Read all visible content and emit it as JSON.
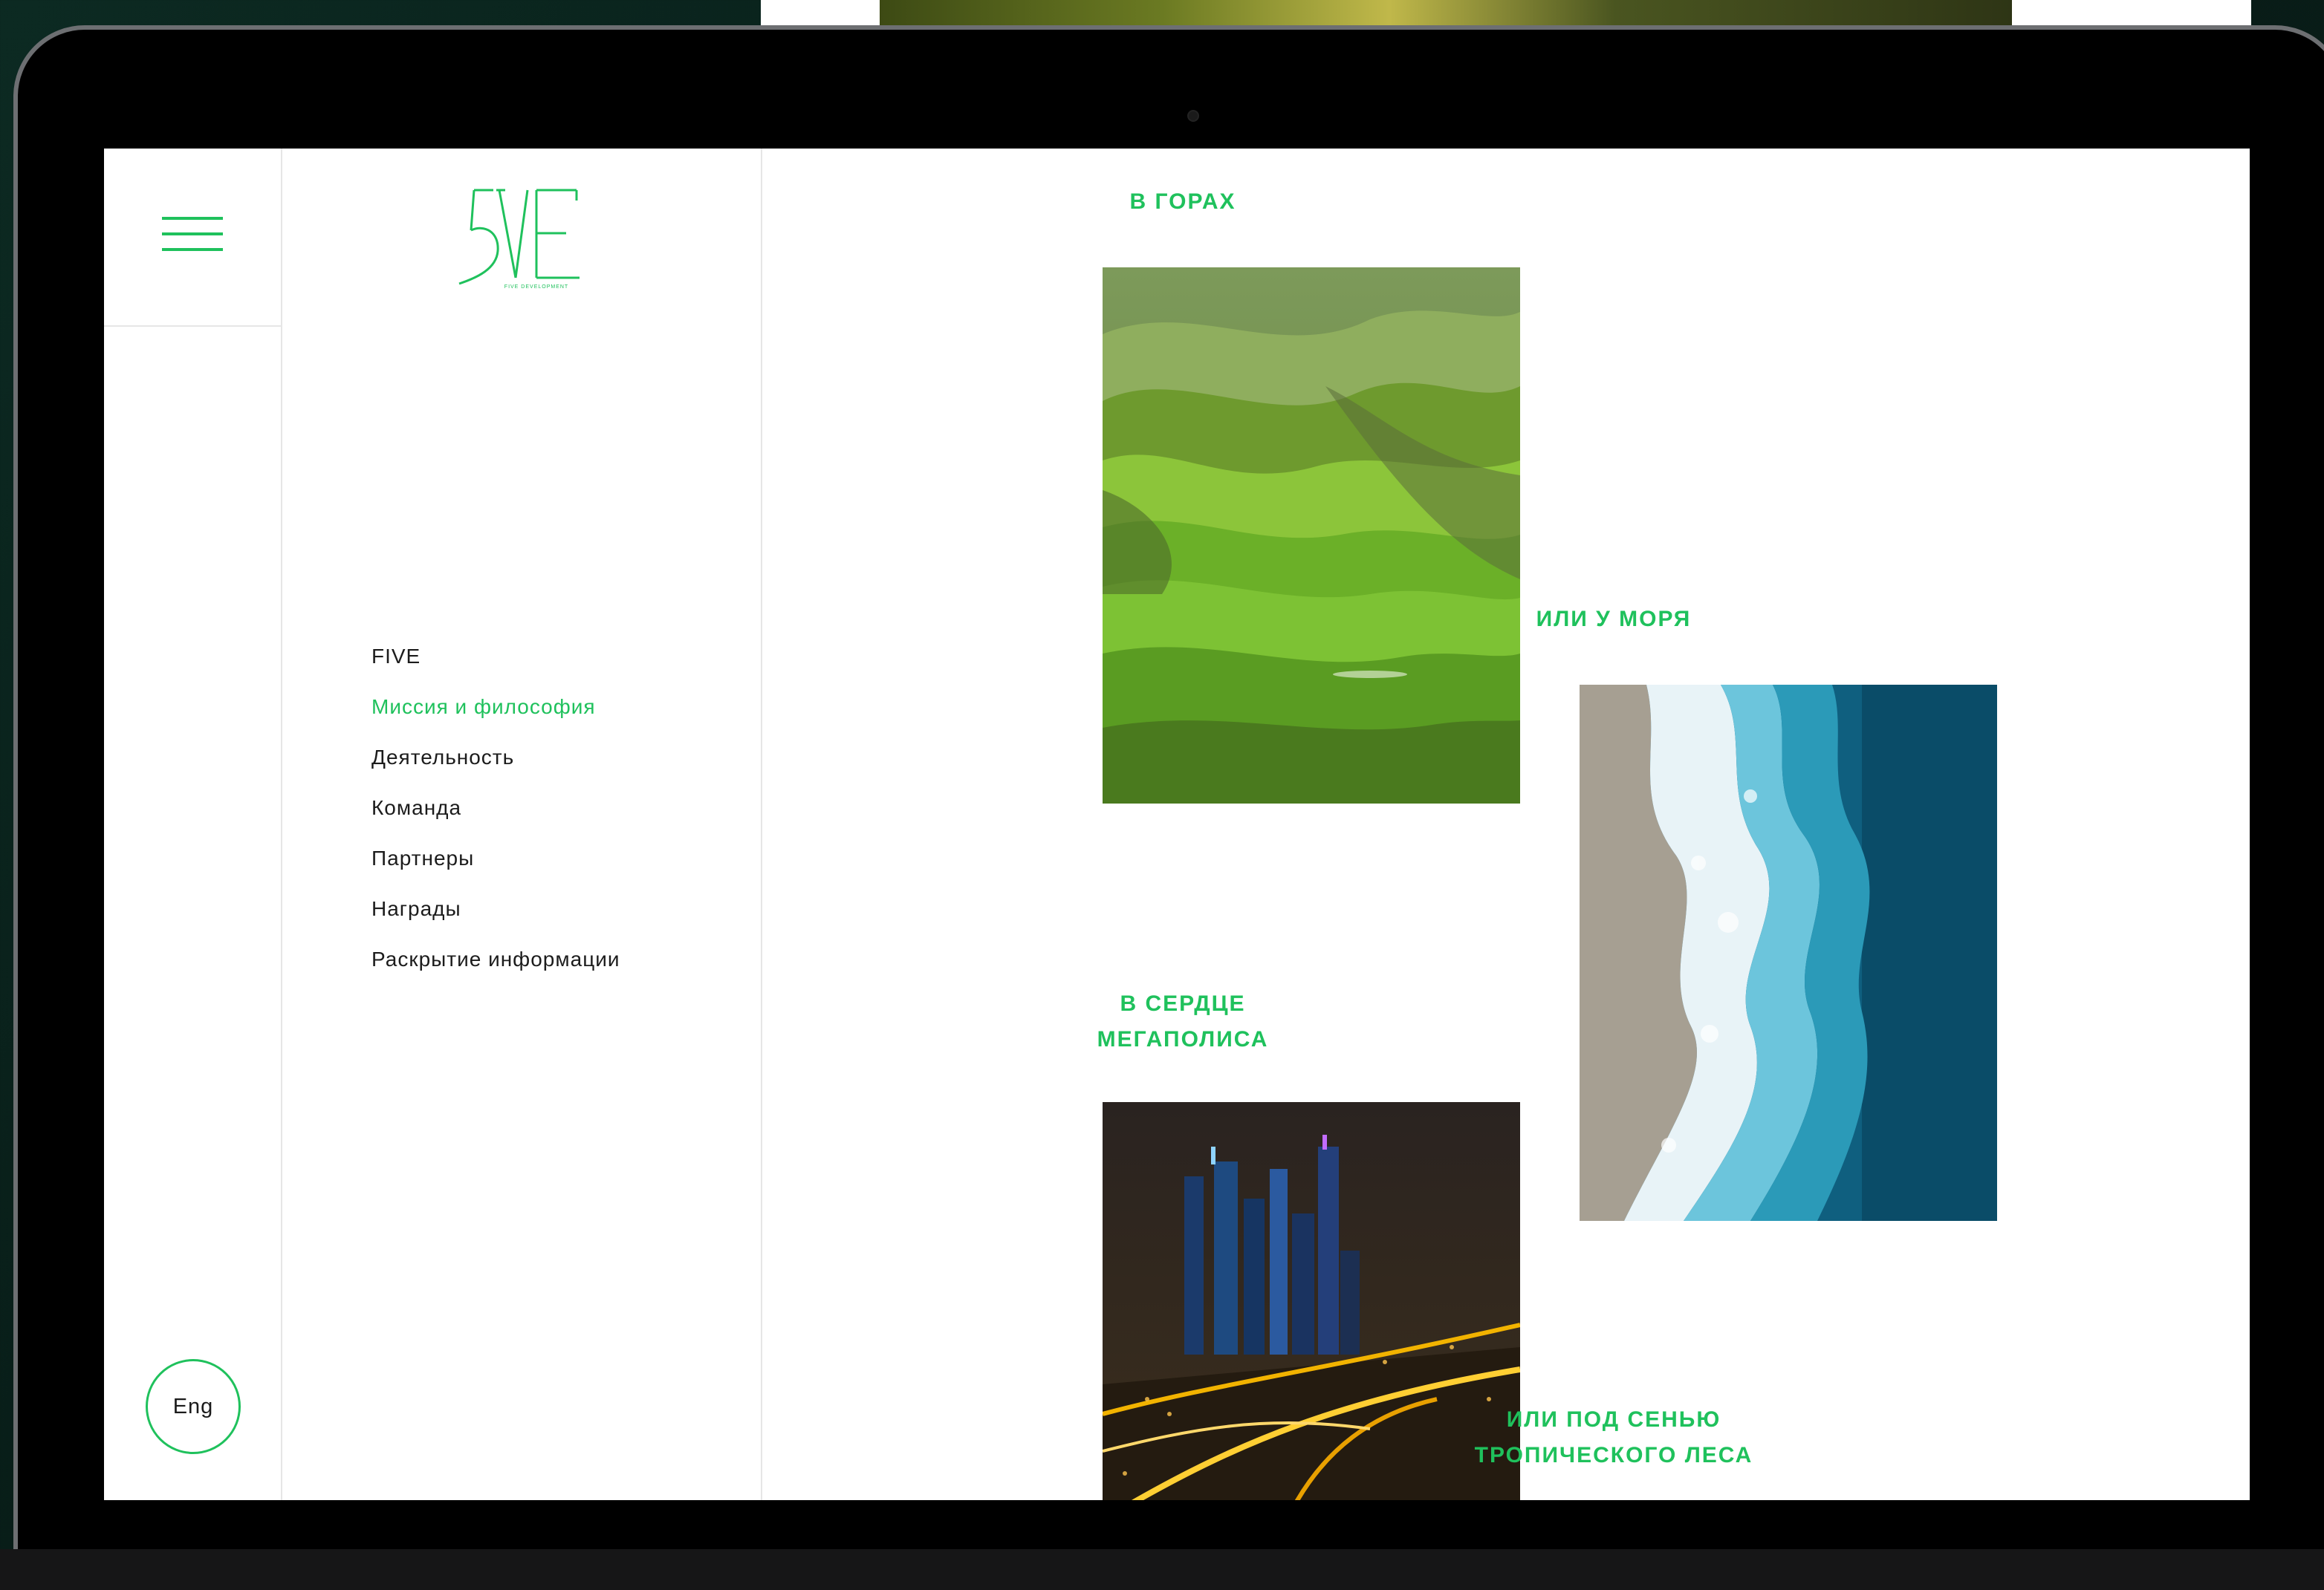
{
  "menu": {
    "icon": "hamburger-menu-icon"
  },
  "language": {
    "label": "Eng"
  },
  "logo": {
    "mark": "5VE",
    "caption": "FIVE DEVELOPMENT"
  },
  "nav": {
    "items": [
      {
        "label": "FIVE",
        "active": false
      },
      {
        "label": "Миссия и философия",
        "active": true
      },
      {
        "label": "Деятельность",
        "active": false
      },
      {
        "label": "Команда",
        "active": false
      },
      {
        "label": "Партнеры",
        "active": false
      },
      {
        "label": "Награды",
        "active": false
      },
      {
        "label": "Раскрытие информации",
        "active": false
      }
    ]
  },
  "sections": {
    "mountains": {
      "title": "В ГОРАХ"
    },
    "sea": {
      "title": "ИЛИ У МОРЯ"
    },
    "city": {
      "title_line1": "В СЕРДЦЕ",
      "title_line2": "МЕГАПОЛИСА"
    },
    "forest": {
      "title_line1": "ИЛИ ПОД СЕНЬЮ",
      "title_line2": "ТРОПИЧЕСКОГО ЛЕСА"
    }
  },
  "colors": {
    "accent": "#1fc15c",
    "text": "#1c1c1c",
    "background": "#ffffff",
    "divider": "#e6e6e6"
  }
}
